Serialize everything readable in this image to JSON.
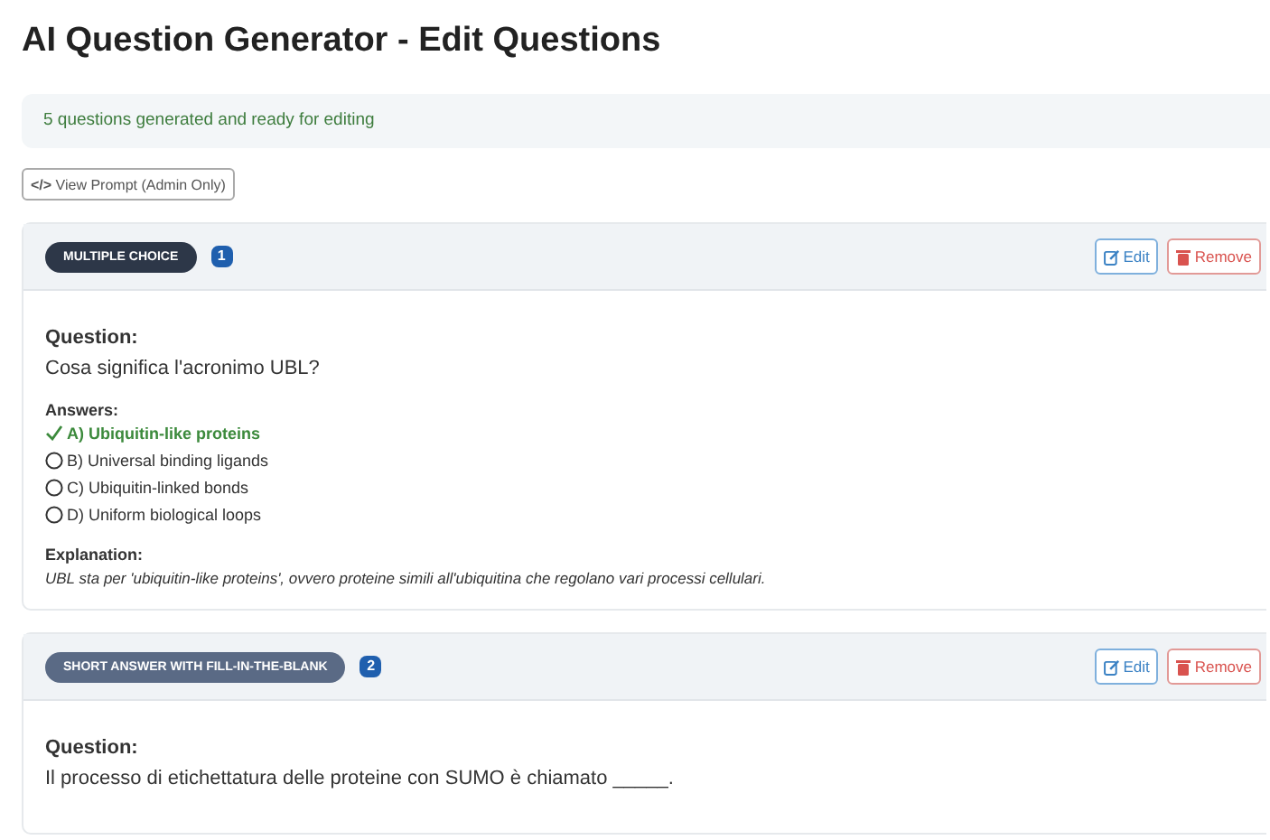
{
  "title": "AI Question Generator - Edit Questions",
  "alert": "5 questions generated and ready for editing",
  "prompt_button": {
    "icon": "</>",
    "label": "View Prompt (Admin Only)"
  },
  "questions": [
    {
      "type": "MULTIPLE CHOICE",
      "color": "#2d3748",
      "number": "1",
      "edit": "Edit",
      "remove": "Remove",
      "question_label": "Question:",
      "question": "Cosa significa l'acronimo UBL?",
      "answers_label": "Answers:",
      "answers": [
        {
          "text": "A) Ubiquitin-like proteins",
          "correct": true
        },
        {
          "text": "B) Universal binding ligands",
          "correct": false
        },
        {
          "text": "C) Ubiquitin-linked bonds",
          "correct": false
        },
        {
          "text": "D) Uniform biological loops",
          "correct": false
        }
      ],
      "explanation_label": "Explanation:",
      "explanation": "UBL sta per 'ubiquitin-like proteins', ovvero proteine simili all'ubiquitina che regolano vari processi cellulari."
    },
    {
      "type": "SHORT ANSWER WITH FILL-IN-THE-BLANK",
      "color": "#5a6a85",
      "number": "2",
      "edit": "Edit",
      "remove": "Remove",
      "question_label": "Question:",
      "question": "Il processo di etichettatura delle proteine con SUMO è chiamato _____."
    }
  ]
}
